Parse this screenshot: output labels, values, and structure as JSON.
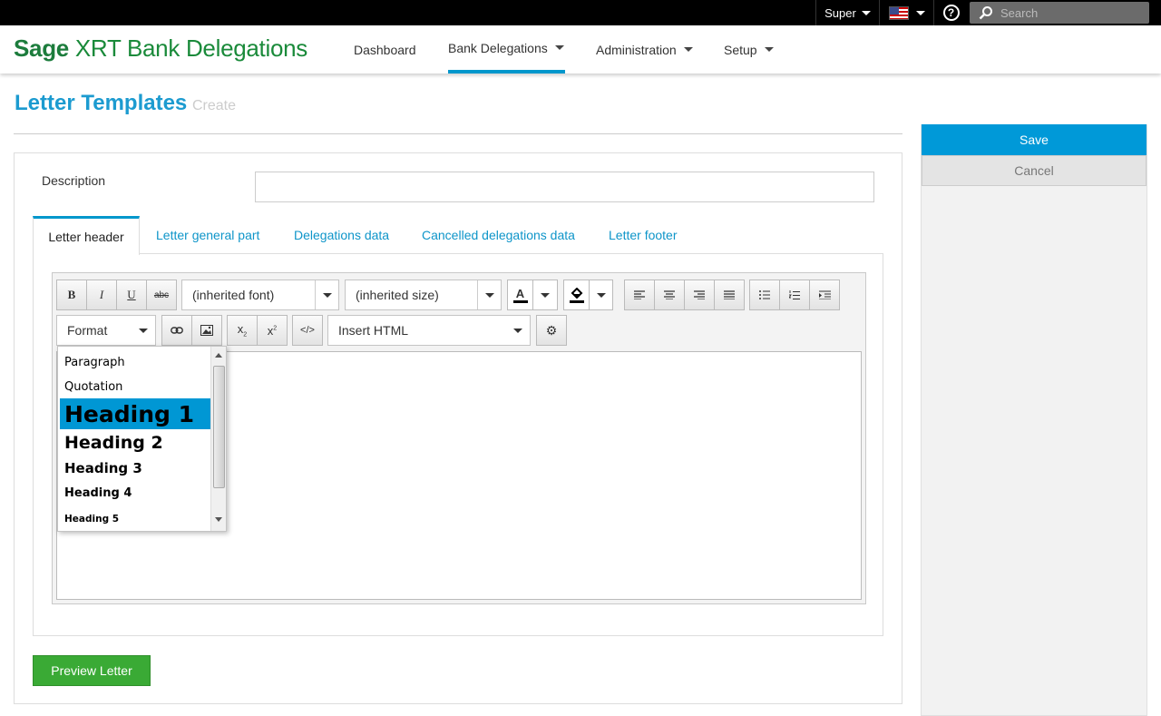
{
  "topbar": {
    "user_label": "Super",
    "search_placeholder": "Search"
  },
  "nav": {
    "brand_bold": "Sage",
    "brand_rest": "XRT Bank Delegations",
    "items": [
      {
        "label": "Dashboard",
        "has_caret": false,
        "active": false
      },
      {
        "label": "Bank Delegations",
        "has_caret": true,
        "active": true
      },
      {
        "label": "Administration",
        "has_caret": true,
        "active": false
      },
      {
        "label": "Setup",
        "has_caret": true,
        "active": false
      }
    ]
  },
  "page": {
    "title": "Letter Templates",
    "subtitle": "Create"
  },
  "form": {
    "description_label": "Description",
    "description_value": ""
  },
  "tabs": [
    {
      "label": "Letter header",
      "active": true
    },
    {
      "label": "Letter general part",
      "active": false
    },
    {
      "label": "Delegations data",
      "active": false
    },
    {
      "label": "Cancelled delegations data",
      "active": false
    },
    {
      "label": "Letter footer",
      "active": false
    }
  ],
  "editor": {
    "font_select": "(inherited font)",
    "size_select": "(inherited size)",
    "format_select": "Format",
    "insert_html_select": "Insert HTML",
    "bold": "B",
    "italic": "I",
    "underline": "U",
    "strike": "abc",
    "text_color_glyph": "A"
  },
  "format_dropdown": {
    "items": [
      {
        "label": "Paragraph",
        "selected": false
      },
      {
        "label": "Quotation",
        "selected": false
      },
      {
        "label": "Heading 1",
        "selected": true
      },
      {
        "label": "Heading 2",
        "selected": false
      },
      {
        "label": "Heading 3",
        "selected": false
      },
      {
        "label": "Heading 4",
        "selected": false
      },
      {
        "label": "Heading 5",
        "selected": false
      }
    ]
  },
  "actions": {
    "save": "Save",
    "cancel": "Cancel",
    "preview": "Preview Letter"
  },
  "colors": {
    "accent": "#0097cc",
    "brand_green": "#1a8a3a",
    "preview_green": "#3aaa35",
    "title_blue": "#1c9bd0"
  }
}
